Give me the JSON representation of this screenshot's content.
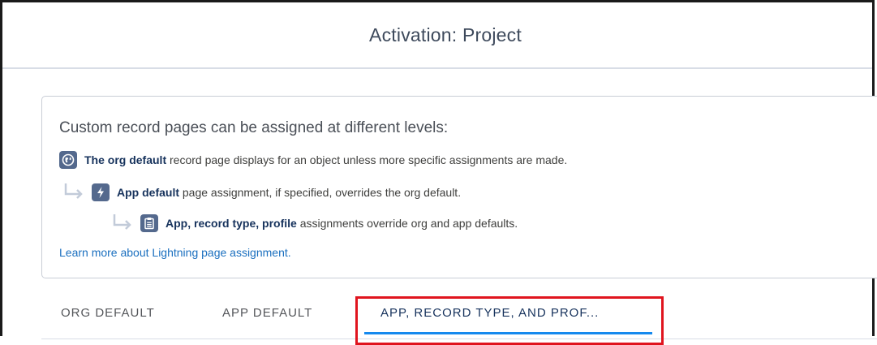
{
  "header": {
    "title": "Activation: Project"
  },
  "info": {
    "heading": "Custom record pages can be assigned at different levels:",
    "levels": [
      {
        "icon": "globe-icon",
        "bold": "The org default",
        "text": " record page displays for an object unless more specific assignments are made."
      },
      {
        "icon": "lightning-bolt-icon",
        "bold": "App default",
        "text": " page assignment, if specified, overrides the org default."
      },
      {
        "icon": "clipboard-icon",
        "bold": "App, record type, profile",
        "text": " assignments override org and app defaults."
      }
    ],
    "learn_more": "Learn more about Lightning page assignment."
  },
  "tabs": [
    {
      "label": "ORG DEFAULT",
      "active": false
    },
    {
      "label": "APP DEFAULT",
      "active": false
    },
    {
      "label": "APP, RECORD TYPE, AND PROF...",
      "active": true
    }
  ],
  "colors": {
    "accent": "#1589ee",
    "icon_badge": "#54698d",
    "highlight": "#e0141e",
    "link": "#1a6fbf"
  }
}
